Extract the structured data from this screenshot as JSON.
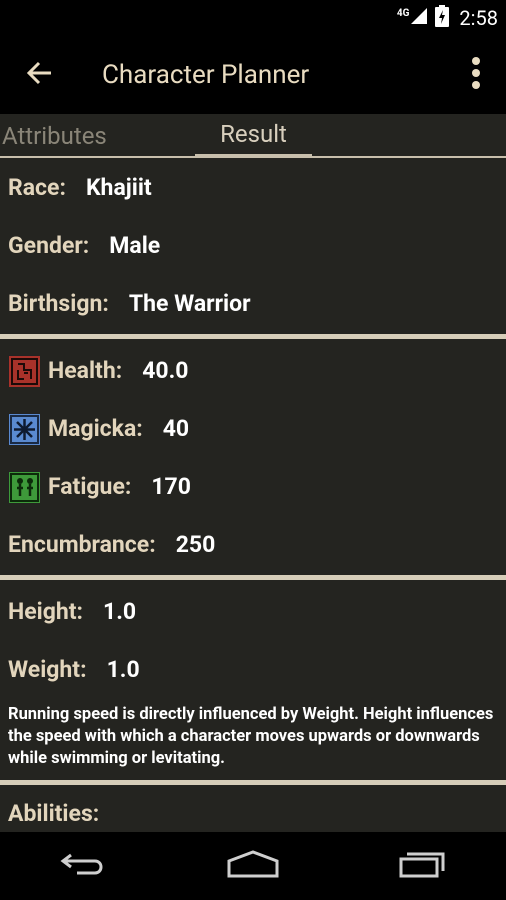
{
  "status_bar": {
    "network": "4G",
    "time": "2:58"
  },
  "action_bar": {
    "title": "Character Planner"
  },
  "tabs": [
    {
      "label": "Attributes",
      "selected": false
    },
    {
      "label": "Result",
      "selected": true
    }
  ],
  "identity": {
    "race": {
      "label": "Race:",
      "value": "Khajiit"
    },
    "gender": {
      "label": "Gender:",
      "value": "Male"
    },
    "birthsign": {
      "label": "Birthsign:",
      "value": "The Warrior"
    }
  },
  "stats": {
    "health": {
      "label": "Health:",
      "value": "40.0",
      "icon": "health-icon",
      "color": "#b8362a"
    },
    "magicka": {
      "label": "Magicka:",
      "value": "40",
      "icon": "magicka-icon",
      "color": "#4a78b8"
    },
    "fatigue": {
      "label": "Fatigue:",
      "value": "170",
      "icon": "fatigue-icon",
      "color": "#3e9a3a"
    },
    "encumbrance": {
      "label": "Encumbrance:",
      "value": "250"
    }
  },
  "body": {
    "height": {
      "label": "Height:",
      "value": "1.0"
    },
    "weight": {
      "label": "Weight:",
      "value": "1.0"
    },
    "note": "Running speed is directly influenced by Weight. Height influences the speed with which a character moves upwards or downwards while swimming or levitating."
  },
  "abilities": {
    "label": "Abilities:"
  },
  "colors": {
    "background": "#242420",
    "label": "#e2d5bc",
    "separator": "#d6cdb9",
    "accent": "#c8bfac"
  }
}
